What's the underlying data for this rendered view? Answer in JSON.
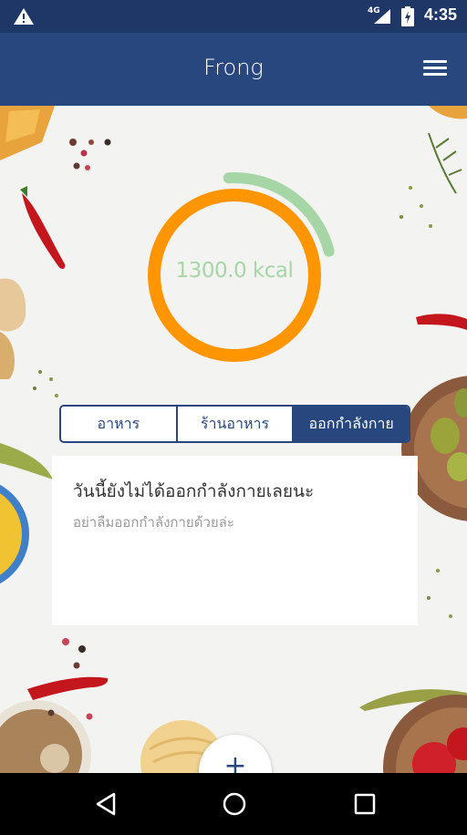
{
  "status_bar": {
    "network": "4G",
    "time": "4:35",
    "icons": [
      "warning-icon",
      "signal-icon",
      "battery-icon"
    ]
  },
  "app_bar": {
    "title": "Frong",
    "menu_icon": "hamburger-menu-icon"
  },
  "summary": {
    "calories_label": "1300.0 kcal",
    "progress_fraction": 0.22
  },
  "tabs": [
    {
      "label": "อาหาร",
      "active": false
    },
    {
      "label": "ร้านอาหาร",
      "active": false
    },
    {
      "label": "ออกกำลังกาย",
      "active": true
    }
  ],
  "card": {
    "title": "วันนี้ยังไม่ได้ออกกำลังกายเลยนะ",
    "subtitle": "อย่าลืมออกกำลังกายด้วยล่ะ"
  },
  "fab": {
    "icon": "plus-icon",
    "label": "+"
  },
  "nav_bar": {
    "icons": [
      "back-icon",
      "home-icon",
      "recents-icon"
    ]
  },
  "colors": {
    "primary": "#27477e",
    "status_bar": "#1e3766",
    "ring_orange": "#ff9500",
    "ring_green": "#a7d6a6"
  }
}
